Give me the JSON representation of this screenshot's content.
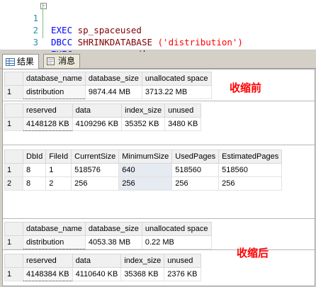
{
  "editor": {
    "lines": [
      {
        "num": "1",
        "kw": "EXEC",
        "fn": "sp_spaceused",
        "arg": ""
      },
      {
        "num": "2",
        "kw": "DBCC",
        "fn": "SHRINKDATABASE",
        "arg": "('distribution')"
      },
      {
        "num": "3",
        "kw": "EXEC",
        "fn": "sp_spaceused",
        "arg": ""
      }
    ]
  },
  "tabs": [
    {
      "label": "结果",
      "icon": "grid-icon",
      "active": true
    },
    {
      "label": "消息",
      "icon": "message-icon",
      "active": false
    }
  ],
  "annotations": {
    "before": "收缩前",
    "after": "收缩后"
  },
  "colors": {
    "annotation": "#ff0000",
    "keyword": "#0000ff",
    "string": "#ff0000",
    "line_number": "#2b91af"
  },
  "grids": [
    {
      "columns": [
        "database_name",
        "database_size",
        "unallocated space"
      ],
      "rows": [
        [
          "1",
          "distribution",
          "9874.44 MB",
          "3713.22 MB"
        ]
      ]
    },
    {
      "columns": [
        "reserved",
        "data",
        "index_size",
        "unused"
      ],
      "rows": [
        [
          "1",
          "4148128 KB",
          "4109296 KB",
          "35352 KB",
          "3480 KB"
        ]
      ]
    },
    {
      "columns": [
        "DbId",
        "FileId",
        "CurrentSize",
        "MinimumSize",
        "UsedPages",
        "EstimatedPages"
      ],
      "rows": [
        [
          "1",
          "8",
          "1",
          "518576",
          "640",
          "518560",
          "518560"
        ],
        [
          "2",
          "8",
          "2",
          "256",
          "256",
          "256",
          "256"
        ]
      ]
    },
    {
      "columns": [
        "database_name",
        "database_size",
        "unallocated space"
      ],
      "rows": [
        [
          "1",
          "distribution",
          "4053.38 MB",
          "0.22 MB"
        ]
      ]
    },
    {
      "columns": [
        "reserved",
        "data",
        "index_size",
        "unused"
      ],
      "rows": [
        [
          "1",
          "4148384 KB",
          "4110640 KB",
          "35368 KB",
          "2376 KB"
        ]
      ]
    }
  ]
}
